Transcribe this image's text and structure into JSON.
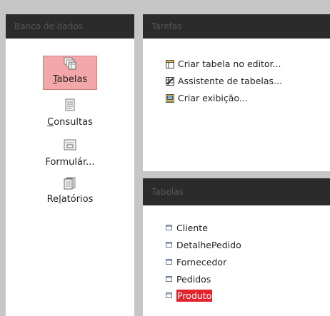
{
  "left_panel": {
    "header": "Banco de dados",
    "items": [
      {
        "pre": "",
        "u": "T",
        "post": "abelas",
        "icon": "tables-icon",
        "selected": true
      },
      {
        "pre": "",
        "u": "C",
        "post": "onsultas",
        "icon": "queries-icon"
      },
      {
        "pre": "",
        "u": "",
        "post": "Formulár...",
        "icon": "forms-icon"
      },
      {
        "pre": "Re",
        "u": "l",
        "post": "atórios",
        "icon": "reports-icon"
      }
    ]
  },
  "tasks_panel": {
    "header": "Tarefas",
    "items": [
      {
        "label": "Criar tabela no editor...",
        "icon": "table-design-icon"
      },
      {
        "label": "Assistente de tabelas...",
        "icon": "table-wizard-icon"
      },
      {
        "label": "Criar exibição...",
        "icon": "create-view-icon"
      }
    ]
  },
  "tables_panel": {
    "header": "Tabelas",
    "items": [
      {
        "label": "Cliente"
      },
      {
        "label": "DetalhePedido"
      },
      {
        "label": "Fornecedor"
      },
      {
        "label": "Pedidos"
      },
      {
        "label": "Produto",
        "selected": true
      }
    ]
  }
}
